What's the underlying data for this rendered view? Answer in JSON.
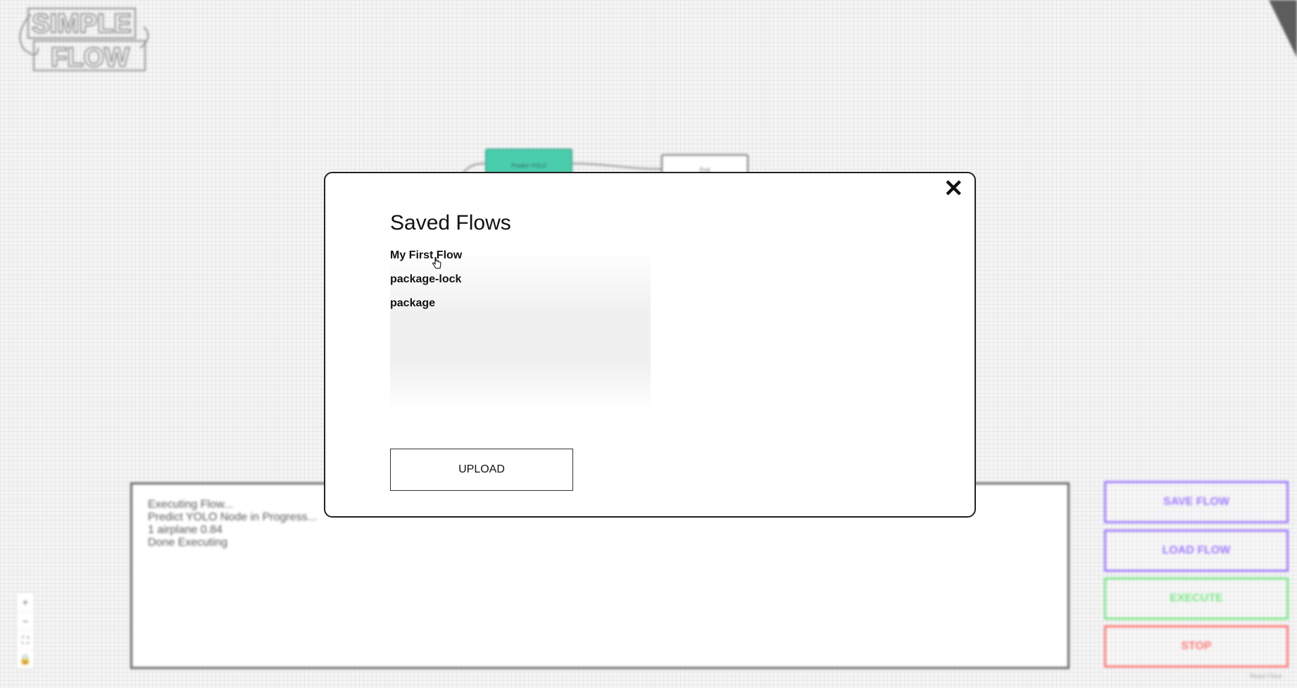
{
  "logo": {
    "line1": "SIMPLE",
    "line2": "FLOW"
  },
  "nodes": {
    "yolo_label": "Predict YOLO",
    "end_label": "End"
  },
  "console": {
    "lines": [
      "Executing Flow...",
      "Predict YOLO Node in Progress...",
      "1 airplane 0.84",
      "Done Executing"
    ]
  },
  "sidebar_buttons": {
    "save": "SAVE FLOW",
    "load": "LOAD FLOW",
    "execute": "EXECUTE",
    "stop": "STOP"
  },
  "canvas_controls": {
    "zoom_in": "+",
    "zoom_out": "−",
    "fit_view": "⛶",
    "lock": "🔒"
  },
  "attribution": "React Flow",
  "modal": {
    "title": "Saved Flows",
    "close_symbol": "✕",
    "flows": [
      "My First Flow",
      "package-lock",
      "package"
    ],
    "upload_label": "UPLOAD"
  },
  "colors": {
    "node_yolo": "#22c39c",
    "save_load_accent": "#8a5cff",
    "execute_accent": "#5ee36d",
    "stop_accent": "#ff5a5a"
  }
}
